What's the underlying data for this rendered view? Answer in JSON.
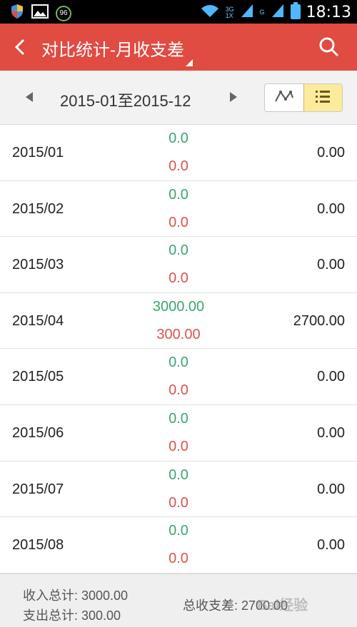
{
  "status_bar": {
    "battery_badge": "96",
    "network_top": "3G",
    "network_bottom": "1X",
    "network_g": "G",
    "time": "18:13",
    "icons": [
      "shield-icon",
      "image-icon",
      "battery-badge-icon",
      "wifi-icon",
      "signal-icon",
      "battery-icon"
    ]
  },
  "app_bar": {
    "title": "对比统计-月收支差",
    "back_icon": "chevron-left-icon",
    "search_icon": "search-icon"
  },
  "range_bar": {
    "range_label": "2015-01至2015-12",
    "view_modes": [
      "chart-icon",
      "list-icon"
    ],
    "active_view": "list-icon"
  },
  "colors": {
    "accent": "#e04b42",
    "income": "#3aa76d",
    "expense": "#d9534f",
    "active_toggle": "#fbeb9b"
  },
  "rows": [
    {
      "month": "2015/01",
      "income": "0.0",
      "expense": "0.0",
      "diff": "0.00"
    },
    {
      "month": "2015/02",
      "income": "0.0",
      "expense": "0.0",
      "diff": "0.00"
    },
    {
      "month": "2015/03",
      "income": "0.0",
      "expense": "0.0",
      "diff": "0.00"
    },
    {
      "month": "2015/04",
      "income": "3000.00",
      "expense": "300.00",
      "diff": "2700.00"
    },
    {
      "month": "2015/05",
      "income": "0.0",
      "expense": "0.0",
      "diff": "0.00"
    },
    {
      "month": "2015/06",
      "income": "0.0",
      "expense": "0.0",
      "diff": "0.00"
    },
    {
      "month": "2015/07",
      "income": "0.0",
      "expense": "0.0",
      "diff": "0.00"
    },
    {
      "month": "2015/08",
      "income": "0.0",
      "expense": "0.0",
      "diff": "0.00"
    }
  ],
  "footer": {
    "income_total": "收入总计: 3000.00",
    "expense_total": "支出总计: 300.00",
    "total_diff": "总收支差: 2700.00"
  },
  "watermark": "Bai经验"
}
